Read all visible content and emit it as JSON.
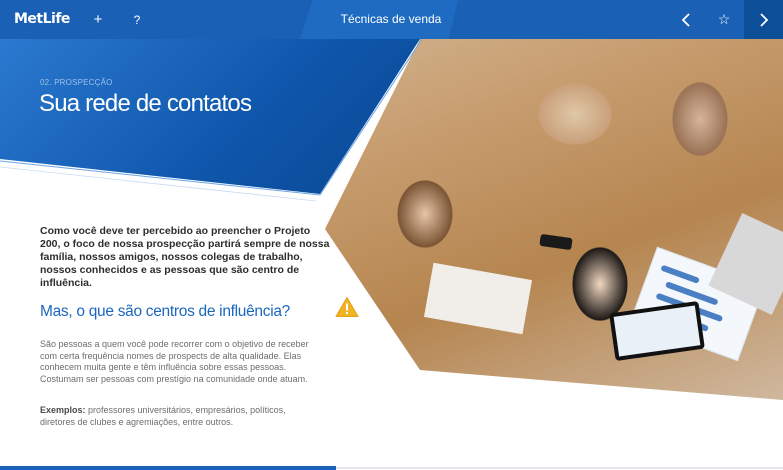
{
  "topbar": {
    "logo": "MetLife",
    "plus_label": "+",
    "help_label": "?",
    "title": "Técnicas de venda",
    "back_label": "‹",
    "favorite_label": "☆",
    "next_label": "›"
  },
  "header": {
    "section": "02. PROSPECÇÃO",
    "title": "Sua rede de contatos"
  },
  "content": {
    "intro": "Como você deve ter percebido ao preencher o Projeto 200, o foco de nossa prospecção partirá sempre de nossa família, nossos amigos, nossos colegas de trabalho, nossos conhecidos e as pessoas que são centro de influência.",
    "question": "Mas, o que são centros de influência?",
    "paragraph": "São pessoas a quem você pode recorrer com o objetivo de receber com certa frequência nomes de prospects de alta qualidade. Elas conhecem muita gente e têm influência sobre essas pessoas. Costumam ser pessoas com prestígio na comunidade onde atuam.",
    "examples_label": "Exemplos:",
    "examples_text": " professores universitários, empresários, políticos, diretores de clubes e agremiações, entre outros."
  },
  "colors": {
    "topbar": "#1a60b4",
    "accent": "#1a67be",
    "warning": "#f0b323"
  }
}
